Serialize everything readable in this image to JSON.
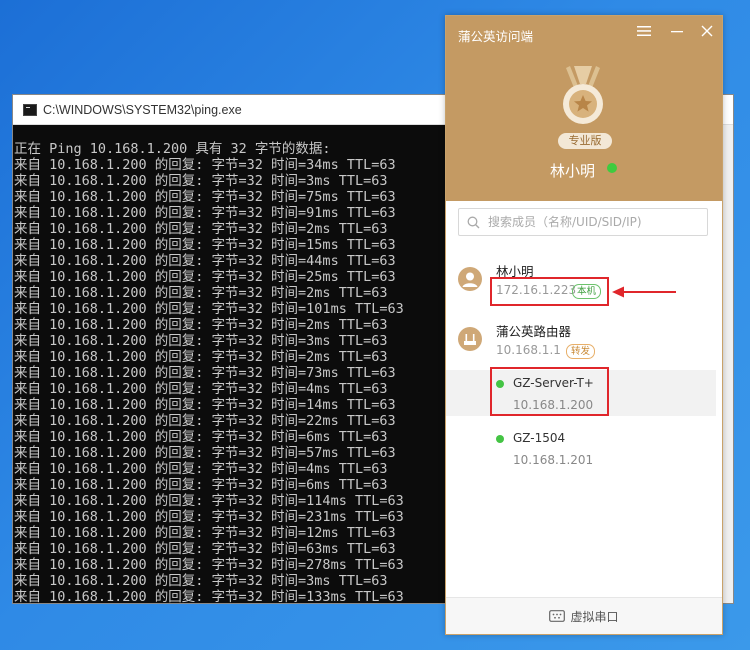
{
  "console": {
    "title": "C:\\WINDOWS\\SYSTEM32\\ping.exe",
    "lines": [
      "正在 Ping 10.168.1.200 具有 32 字节的数据:",
      "来自 10.168.1.200 的回复: 字节=32 时间=34ms TTL=63",
      "来自 10.168.1.200 的回复: 字节=32 时间=3ms TTL=63",
      "来自 10.168.1.200 的回复: 字节=32 时间=75ms TTL=63",
      "来自 10.168.1.200 的回复: 字节=32 时间=91ms TTL=63",
      "来自 10.168.1.200 的回复: 字节=32 时间=2ms TTL=63",
      "来自 10.168.1.200 的回复: 字节=32 时间=15ms TTL=63",
      "来自 10.168.1.200 的回复: 字节=32 时间=44ms TTL=63",
      "来自 10.168.1.200 的回复: 字节=32 时间=25ms TTL=63",
      "来自 10.168.1.200 的回复: 字节=32 时间=2ms TTL=63",
      "来自 10.168.1.200 的回复: 字节=32 时间=101ms TTL=63",
      "来自 10.168.1.200 的回复: 字节=32 时间=2ms TTL=63",
      "来自 10.168.1.200 的回复: 字节=32 时间=3ms TTL=63",
      "来自 10.168.1.200 的回复: 字节=32 时间=2ms TTL=63",
      "来自 10.168.1.200 的回复: 字节=32 时间=73ms TTL=63",
      "来自 10.168.1.200 的回复: 字节=32 时间=4ms TTL=63",
      "来自 10.168.1.200 的回复: 字节=32 时间=14ms TTL=63",
      "来自 10.168.1.200 的回复: 字节=32 时间=22ms TTL=63",
      "来自 10.168.1.200 的回复: 字节=32 时间=6ms TTL=63",
      "来自 10.168.1.200 的回复: 字节=32 时间=57ms TTL=63",
      "来自 10.168.1.200 的回复: 字节=32 时间=4ms TTL=63",
      "来自 10.168.1.200 的回复: 字节=32 时间=6ms TTL=63",
      "来自 10.168.1.200 的回复: 字节=32 时间=114ms TTL=63",
      "来自 10.168.1.200 的回复: 字节=32 时间=231ms TTL=63",
      "来自 10.168.1.200 的回复: 字节=32 时间=12ms TTL=63",
      "来自 10.168.1.200 的回复: 字节=32 时间=63ms TTL=63",
      "来自 10.168.1.200 的回复: 字节=32 时间=278ms TTL=63",
      "来自 10.168.1.200 的回复: 字节=32 时间=3ms TTL=63",
      "来自 10.168.1.200 的回复: 字节=32 时间=133ms TTL=63"
    ]
  },
  "app": {
    "title": "蒲公英访问端",
    "edition": "专业版",
    "user_name": "林小明",
    "search_placeholder": "搜索成员（名称/UID/SID/IP)",
    "members": [
      {
        "name": "林小明",
        "ip": "172.16.1.223",
        "tag": "本机"
      },
      {
        "name": "蒲公英路由器",
        "ip": "10.168.1.1",
        "tag": "转发"
      }
    ],
    "devices": [
      {
        "name": "GZ-Server-T+",
        "ip": "10.168.1.200"
      },
      {
        "name": "GZ-1504",
        "ip": "10.168.1.201"
      }
    ],
    "footer_label": "虚拟串口"
  },
  "colors": {
    "brand": "#c49a63",
    "online": "#3fcb3f",
    "highlight": "#e0262b"
  }
}
